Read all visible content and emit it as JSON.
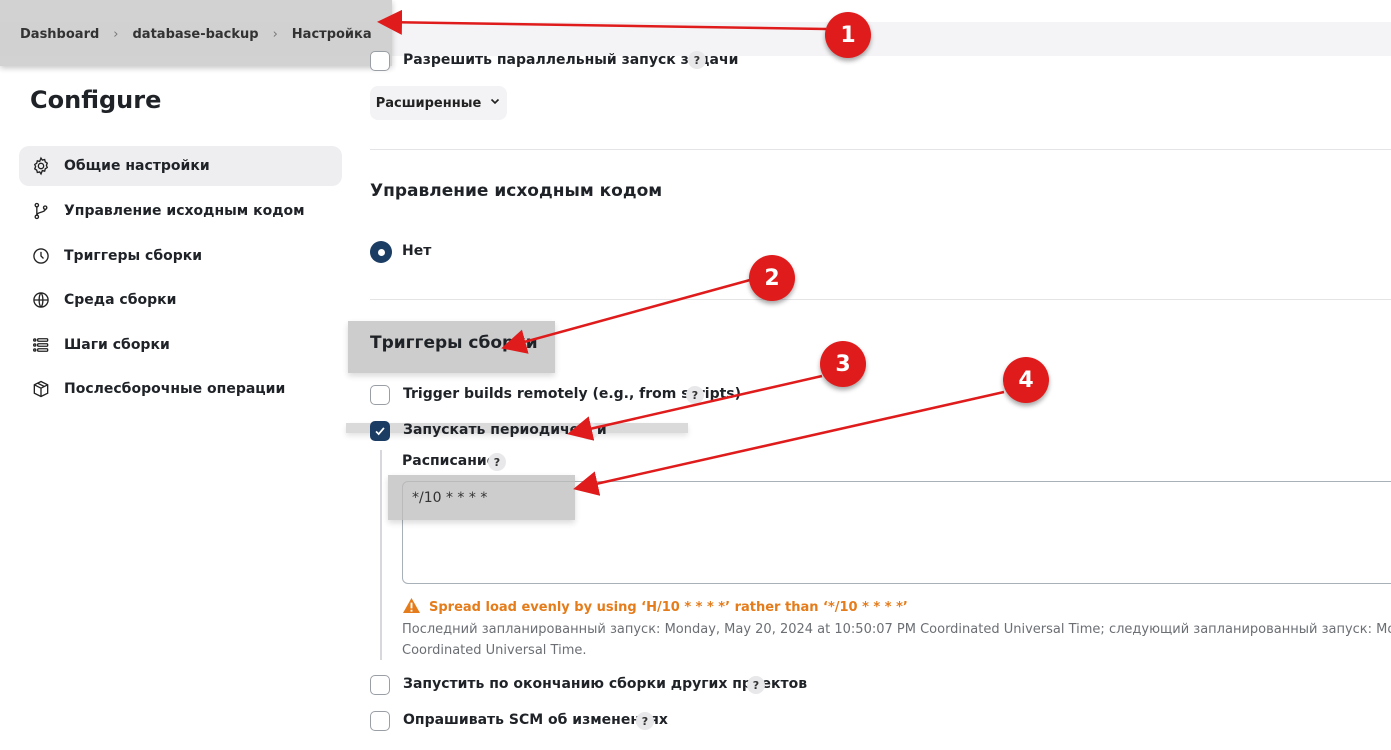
{
  "breadcrumb": [
    "Dashboard",
    "database-backup",
    "Настройка"
  ],
  "page_title": "Configure",
  "nav": [
    {
      "label": "Общие настройки",
      "icon": "gear-icon",
      "active": true
    },
    {
      "label": "Управление исходным кодом",
      "icon": "branch-icon"
    },
    {
      "label": "Триггеры сборки",
      "icon": "clock-icon"
    },
    {
      "label": "Среда сборки",
      "icon": "globe-icon"
    },
    {
      "label": "Шаги сборки",
      "icon": "list-icon"
    },
    {
      "label": "Послесборочные операции",
      "icon": "package-icon"
    }
  ],
  "general": {
    "parallel_label": "Разрешить параллельный запуск задачи",
    "advanced_label": "Расширенные"
  },
  "scm": {
    "title": "Управление исходным кодом",
    "option_none": "Нет"
  },
  "triggers": {
    "title": "Триггеры сборки",
    "remote_label": "Trigger builds remotely (e.g., from scripts)",
    "periodic_label": "Запускать периодически",
    "schedule_label": "Расписание",
    "schedule_value": "*/10 * * * *",
    "warning": "Spread load evenly by using ‘H/10 * * * *’ rather than ‘*/10 * * * *’",
    "info_line1": "Последний запланированный запуск: Monday, May 20, 2024 at 10:50:07 PM Coordinated Universal Time; следующий запланированный запуск: Monday,",
    "info_line2": "Coordinated Universal Time.",
    "after_other_label": "Запустить по окончанию сборки других проектов",
    "poll_scm_label": "Опрашивать SCM об изменениях",
    "help": "?"
  },
  "annotations": [
    "1",
    "2",
    "3",
    "4"
  ],
  "colors": {
    "accent": "#1c3d63",
    "warning": "#e57c1b",
    "annotation": "#e01b1b"
  }
}
